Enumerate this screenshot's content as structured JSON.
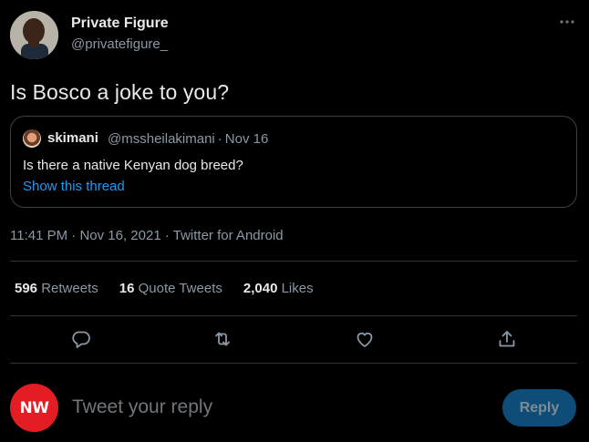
{
  "author": {
    "name": "Private Figure",
    "handle": "@privatefigure_",
    "avatar_icon": "person-photo-avatar"
  },
  "tweet": {
    "text": "Is Bosco a joke to you?"
  },
  "quoted": {
    "name": "skimani",
    "handle": "@mssheilakimani",
    "separator": "·",
    "date": "Nov 16",
    "text": "Is there a native Kenyan dog breed?",
    "thread_link": "Show this thread",
    "avatar_icon": "person-photo-avatar"
  },
  "timestamp": {
    "time": "11:41 PM",
    "date": "Nov 16, 2021",
    "source": "Twitter for Android",
    "separator": "·"
  },
  "stats": {
    "retweets_count": "596",
    "retweets_label": "Retweets",
    "quotes_count": "16",
    "quotes_label": "Quote Tweets",
    "likes_count": "2,040",
    "likes_label": "Likes"
  },
  "actions": [
    {
      "icon": "reply-icon"
    },
    {
      "icon": "retweet-icon"
    },
    {
      "icon": "like-icon"
    },
    {
      "icon": "share-icon"
    }
  ],
  "reply_box": {
    "avatar_text": "NW",
    "avatar_color": "#e31d23",
    "placeholder": "Tweet your reply",
    "button_label": "Reply"
  },
  "colors": {
    "background": "#000000",
    "text": "#e7e9ea",
    "secondary_text": "#8b98a5",
    "link": "#1d9bf0",
    "border": "#2f3336",
    "reply_button": "#0e4d78"
  }
}
